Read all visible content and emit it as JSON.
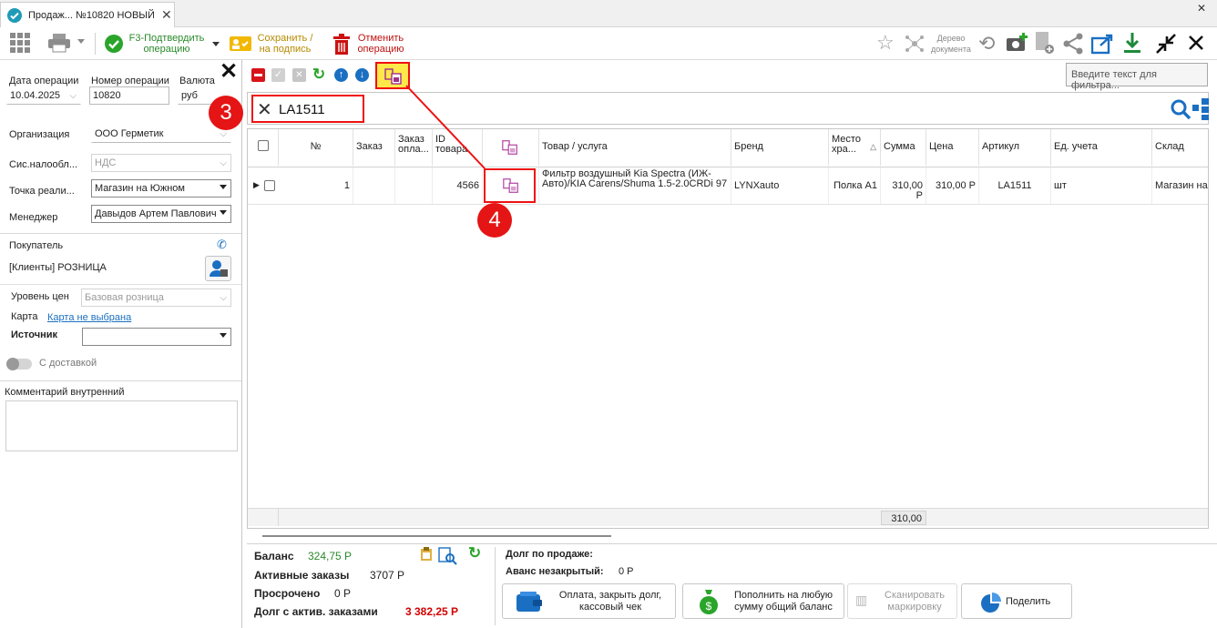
{
  "tab": {
    "title": "Продаж... №10820 НОВЫЙ"
  },
  "toolbar": {
    "confirm_label": "F3-Подтвердить операцию",
    "save_label": "Сохранить / на подпись",
    "cancel_label": "Отменить операцию",
    "tree_label": "Дерево документа"
  },
  "form": {
    "date_label": "Дата операции",
    "date_value": "10.04.2025",
    "number_label": "Номер операции",
    "number_value": "10820",
    "currency_label": "Валюта",
    "currency_value": "руб",
    "org_label": "Организация",
    "org_value": "ООО Герметик",
    "tax_label": "Сис.налообл...",
    "tax_value": "НДС",
    "point_label": "Точка реали...",
    "point_value": "Магазин на Южном",
    "manager_label": "Менеджер",
    "manager_value": "Давыдов Артем Павлович",
    "buyer_label": "Покупатель",
    "buyer_value": "[Клиенты] РОЗНИЦА",
    "price_level_label": "Уровень цен",
    "price_level_value": "Базовая розница",
    "card_label": "Карта",
    "card_link": "Карта не выбрана",
    "source_label": "Источник",
    "delivery_label": "С доставкой",
    "comment_label": "Комментарий внутренний"
  },
  "filter": {
    "value": "LA1511",
    "placeholder": "Введите текст для фильтра..."
  },
  "grid": {
    "columns": [
      "№",
      "Заказ",
      "Заказ опла...",
      "ID товара",
      "",
      "Товар  /  услуга",
      "Бренд",
      "Место хра...",
      "Сумма",
      "Цена",
      "Артикул",
      "Ед. учета",
      "Склад"
    ],
    "rows": [
      {
        "num": "1",
        "id": "4566",
        "product": "Фильтр воздушный Kia Spectra (ИЖ-Авто)/KIA Carens/Shuma 1.5-2.0CRDi 97",
        "brand": "LYNXauto",
        "place": "Полка А1",
        "sum": "310,00 Р",
        "price": "310,00 Р",
        "article": "LA1511",
        "unit": "шт",
        "warehouse": "Магазин на"
      }
    ],
    "total_sum": "310,00"
  },
  "footer": {
    "balance_label": "Баланс",
    "balance_value": "324,75 Р",
    "active_label": "Активные заказы",
    "active_value": "3707 Р",
    "overdue_label": "Просрочено",
    "overdue_value": "0 Р",
    "debt_label": "Долг с актив. заказами",
    "debt_value": "3 382,25 Р",
    "sale_debt_label": "Долг по продаже:",
    "advance_label": "Аванс незакрытый:",
    "advance_value": "0 Р",
    "pay_button": "Оплата, закрыть долг, кассовый чек",
    "topup_button": "Пополнить на любую сумму общий баланс",
    "scan_button": "Сканировать маркировку",
    "share_button": "Поделить"
  },
  "annotations": {
    "a3": "3",
    "a4": "4"
  },
  "colors": {
    "accent_green": "#2aa52a",
    "annotation_red": "#e51515",
    "link_blue": "#1a6fc2",
    "debt_red": "#d40000"
  }
}
